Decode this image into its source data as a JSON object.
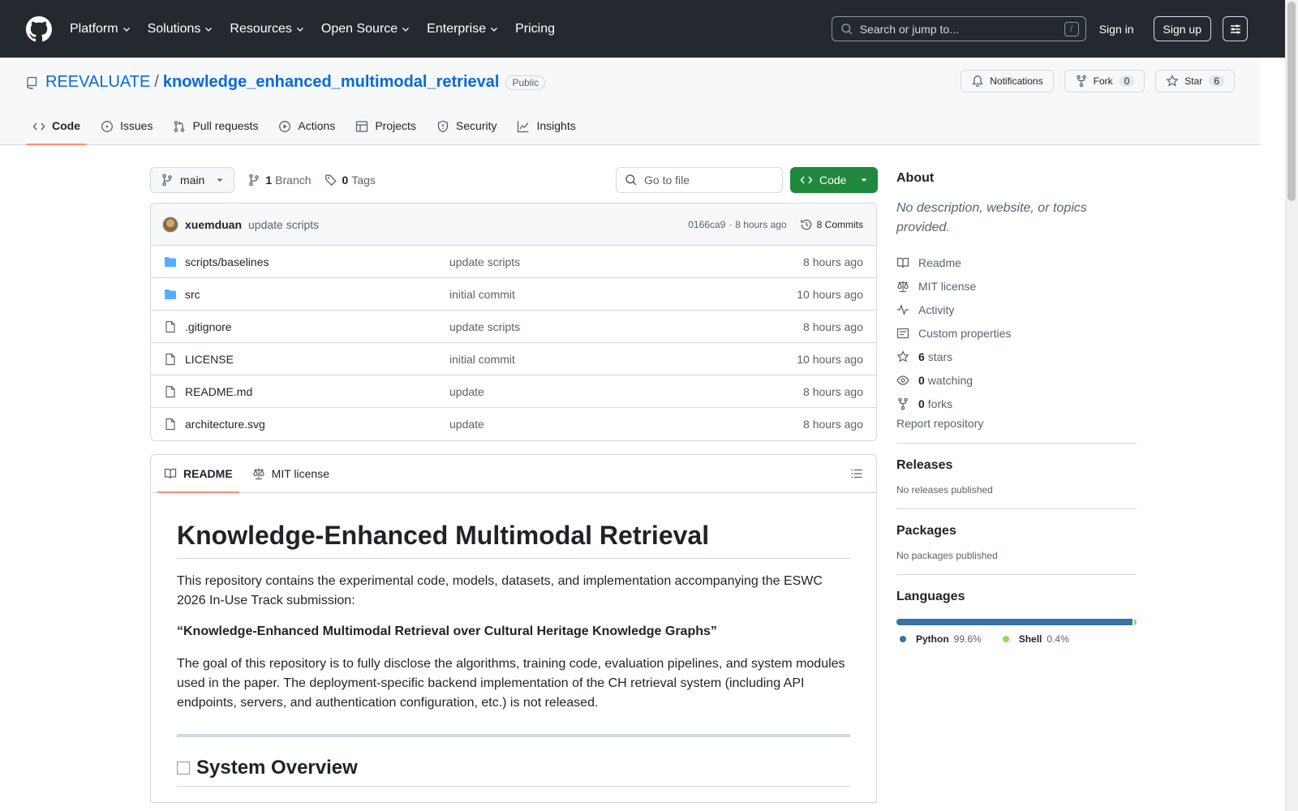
{
  "header": {
    "nav": [
      {
        "label": "Platform",
        "has_menu": true
      },
      {
        "label": "Solutions",
        "has_menu": true
      },
      {
        "label": "Resources",
        "has_menu": true
      },
      {
        "label": "Open Source",
        "has_menu": true
      },
      {
        "label": "Enterprise",
        "has_menu": true
      },
      {
        "label": "Pricing",
        "has_menu": false
      }
    ],
    "search_placeholder": "Search or jump to...",
    "search_shortcut": "/",
    "signin": "Sign in",
    "signup": "Sign up"
  },
  "repo": {
    "owner": "REEVALUATE",
    "separator": "/",
    "name": "knowledge_enhanced_multimodal_retrieval",
    "visibility": "Public",
    "notifications_label": "Notifications",
    "fork_label": "Fork",
    "fork_count": "0",
    "star_label": "Star",
    "star_count": "6",
    "tabs": [
      {
        "label": "Code",
        "icon": "code-icon",
        "active": true
      },
      {
        "label": "Issues",
        "icon": "issue-icon",
        "active": false
      },
      {
        "label": "Pull requests",
        "icon": "pull-request-icon",
        "active": false
      },
      {
        "label": "Actions",
        "icon": "play-icon",
        "active": false
      },
      {
        "label": "Projects",
        "icon": "table-icon",
        "active": false
      },
      {
        "label": "Security",
        "icon": "shield-icon",
        "active": false
      },
      {
        "label": "Insights",
        "icon": "graph-icon",
        "active": false
      }
    ]
  },
  "toolbar": {
    "branch": "main",
    "branch_count": "1",
    "branch_label": "Branch",
    "tag_count": "0",
    "tag_label": "Tags",
    "goto_placeholder": "Go to file",
    "code_button": "Code"
  },
  "latest_commit": {
    "author": "xuemduan",
    "message": "update scripts",
    "sha": "0166ca9",
    "separator": "·",
    "time": "8 hours ago",
    "commits_label": "8 Commits"
  },
  "files": [
    {
      "name": "scripts/baselines",
      "type": "folder",
      "message": "update scripts",
      "time": "8 hours ago"
    },
    {
      "name": "src",
      "type": "folder",
      "message": "initial commit",
      "time": "10 hours ago"
    },
    {
      "name": ".gitignore",
      "type": "file",
      "message": "update scripts",
      "time": "8 hours ago"
    },
    {
      "name": "LICENSE",
      "type": "file",
      "message": "initial commit",
      "time": "10 hours ago"
    },
    {
      "name": "README.md",
      "type": "file",
      "message": "update",
      "time": "8 hours ago"
    },
    {
      "name": "architecture.svg",
      "type": "file",
      "message": "update",
      "time": "8 hours ago"
    }
  ],
  "readme": {
    "tab_readme": "README",
    "tab_license": "MIT license",
    "title": "Knowledge-Enhanced Multimodal Retrieval",
    "p1": "This repository contains the experimental code, models, datasets, and implementation accompanying the ESWC 2026 In-Use Track submission:",
    "quote": "“Knowledge-Enhanced Multimodal Retrieval over Cultural Heritage Knowledge Graphs”",
    "p2": "The goal of this repository is to fully disclose the algorithms, training code, evaluation pipelines, and system modules used in the paper. The deployment-specific backend implementation of the CH retrieval system (including API endpoints, servers, and authentication configuration, etc.) is not released.",
    "h2": "System Overview"
  },
  "sidebar": {
    "about_title": "About",
    "about_desc": "No description, website, or topics provided.",
    "links": [
      {
        "icon": "book-icon",
        "count": "",
        "label": "Readme"
      },
      {
        "icon": "law-icon",
        "count": "",
        "label": "MIT license"
      },
      {
        "icon": "pulse-icon",
        "count": "",
        "label": "Activity"
      },
      {
        "icon": "note-icon",
        "count": "",
        "label": "Custom properties"
      },
      {
        "icon": "star-icon",
        "count": "6",
        "label": "stars"
      },
      {
        "icon": "eye-icon",
        "count": "0",
        "label": "watching"
      },
      {
        "icon": "fork-icon",
        "count": "0",
        "label": "forks"
      }
    ],
    "report": "Report repository",
    "releases_title": "Releases",
    "releases_text": "No releases published",
    "packages_title": "Packages",
    "packages_text": "No packages published",
    "languages_title": "Languages",
    "languages": [
      {
        "name": "Python",
        "percent": "99.6%",
        "fraction": 0.996,
        "color": "#3572A5"
      },
      {
        "name": "Shell",
        "percent": "0.4%",
        "fraction": 0.004,
        "color": "#89e051"
      }
    ]
  }
}
